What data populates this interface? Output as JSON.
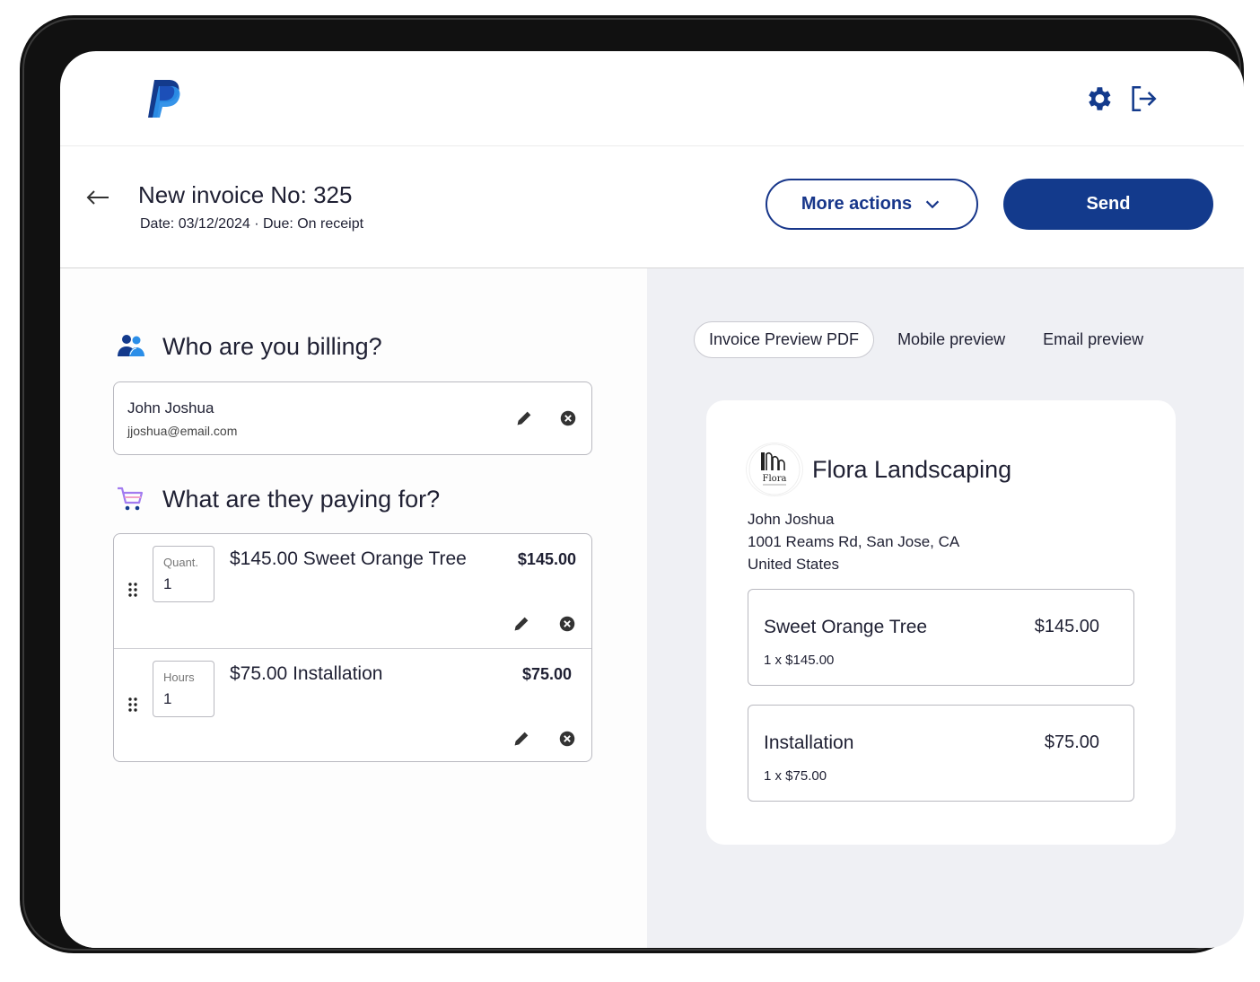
{
  "header": {
    "title": "New invoice No: 325",
    "subtitle": "Date: 03/12/2024 · Due: On receipt",
    "more_actions_label": "More actions",
    "send_label": "Send"
  },
  "billing": {
    "heading": "Who are you billing?",
    "client_name": "John Joshua",
    "client_email": "jjoshua@email.com"
  },
  "items_section": {
    "heading": "What are they paying for?",
    "items": [
      {
        "qty_label": "Quant.",
        "qty": "1",
        "description": "$145.00 Sweet Orange Tree",
        "amount": "$145.00"
      },
      {
        "qty_label": "Hours",
        "qty": "1",
        "description": "$75.00 Installation",
        "amount": "$75.00"
      }
    ]
  },
  "preview_tabs": [
    "Invoice Preview PDF",
    "Mobile preview",
    "Email preview"
  ],
  "preview": {
    "business_name": "Flora Landscaping",
    "address_lines": [
      "John Joshua",
      "1001 Reams Rd, San Jose, CA",
      "United States"
    ],
    "items": [
      {
        "name": "Sweet Orange Tree",
        "amount": "$145.00",
        "detail": "1 x $145.00"
      },
      {
        "name": "Installation",
        "amount": "$75.00",
        "detail": "1 x $75.00"
      }
    ]
  },
  "icons": {
    "brand": "paypal-logo",
    "settings": "gear-icon",
    "logout": "logout-icon",
    "back": "arrow-left-icon",
    "billing": "people-icon",
    "paying": "cart-icon",
    "edit": "pencil-icon",
    "remove": "close-circle-icon",
    "drag": "drag-handle-icon"
  },
  "colors": {
    "brand_primary": "#133a8c",
    "brand_light": "#2b8ee8",
    "cart_accent": "#a27bf0",
    "preview_bg": "#eff0f4"
  }
}
